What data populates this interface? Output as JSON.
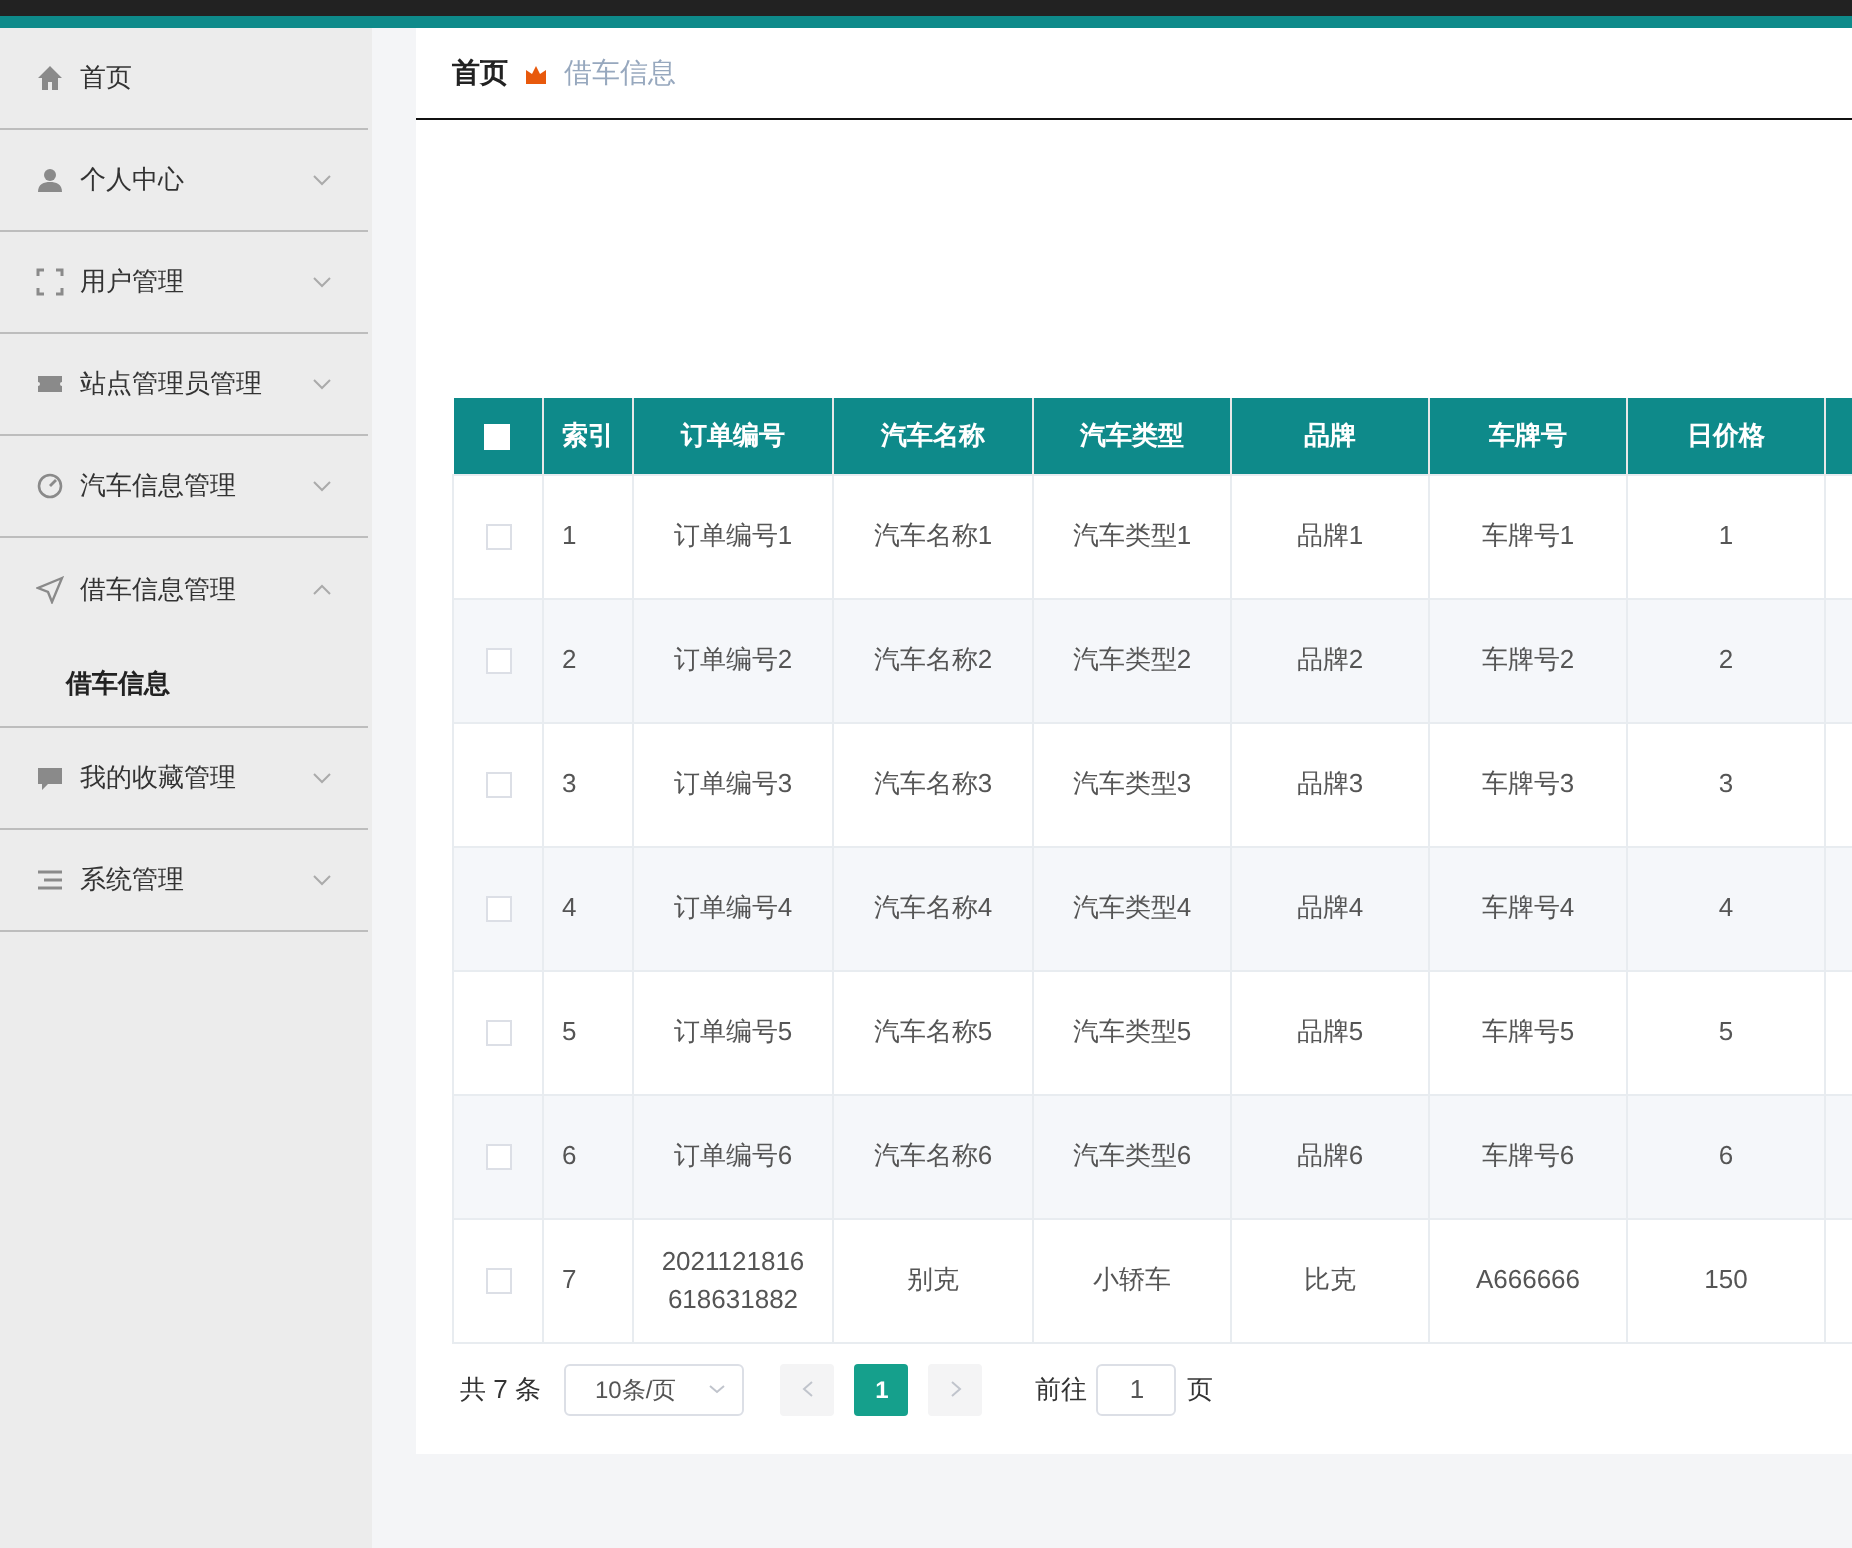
{
  "sidebar": {
    "items": [
      {
        "label": "首页",
        "kind": "link"
      },
      {
        "label": "个人中心",
        "kind": "menu",
        "expanded": false
      },
      {
        "label": "用户管理",
        "kind": "menu",
        "expanded": false
      },
      {
        "label": "站点管理员管理",
        "kind": "menu",
        "expanded": false
      },
      {
        "label": "汽车信息管理",
        "kind": "menu",
        "expanded": false
      },
      {
        "label": "借车信息管理",
        "kind": "menu",
        "expanded": true,
        "children": [
          {
            "label": "借车信息",
            "selected": true
          }
        ]
      },
      {
        "label": "我的收藏管理",
        "kind": "menu",
        "expanded": false
      },
      {
        "label": "系统管理",
        "kind": "menu",
        "expanded": false
      }
    ]
  },
  "breadcrumb": [
    "首页",
    "借车信息"
  ],
  "table": {
    "select_all": {
      "checked": false
    },
    "columns": [
      "索引",
      "订单编号",
      "汽车名称",
      "汽车类型",
      "品牌",
      "车牌号",
      "日价格"
    ],
    "rows": [
      {
        "checked": false,
        "cells": [
          "1",
          "订单编号1",
          "汽车名称1",
          "汽车类型1",
          "品牌1",
          "车牌号1",
          "1"
        ]
      },
      {
        "checked": false,
        "cells": [
          "2",
          "订单编号2",
          "汽车名称2",
          "汽车类型2",
          "品牌2",
          "车牌号2",
          "2"
        ]
      },
      {
        "checked": false,
        "cells": [
          "3",
          "订单编号3",
          "汽车名称3",
          "汽车类型3",
          "品牌3",
          "车牌号3",
          "3"
        ]
      },
      {
        "checked": false,
        "cells": [
          "4",
          "订单编号4",
          "汽车名称4",
          "汽车类型4",
          "品牌4",
          "车牌号4",
          "4"
        ]
      },
      {
        "checked": false,
        "cells": [
          "5",
          "订单编号5",
          "汽车名称5",
          "汽车类型5",
          "品牌5",
          "车牌号5",
          "5"
        ]
      },
      {
        "checked": false,
        "cells": [
          "6",
          "订单编号6",
          "汽车名称6",
          "汽车类型6",
          "品牌6",
          "车牌号6",
          "6"
        ]
      },
      {
        "checked": false,
        "cells": [
          "7",
          "2021121816618631882",
          "别克",
          "小轿车",
          "比克",
          "A666666",
          "150"
        ]
      }
    ]
  },
  "pagination": {
    "total": "共 7 条",
    "page_size": "10条/页",
    "pages": [
      {
        "label": "1",
        "selected": true
      }
    ],
    "goto_label": "前往",
    "goto_value": "1",
    "goto_suffix": "页"
  }
}
